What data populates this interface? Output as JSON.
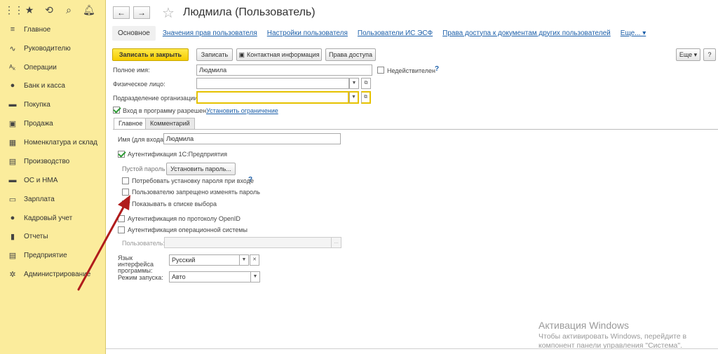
{
  "sidebar": {
    "top_icons": [
      "grid-icon",
      "star-icon",
      "history-icon",
      "search-icon",
      "bell-icon"
    ],
    "items": [
      {
        "label": "Главное",
        "icon": "≡"
      },
      {
        "label": "Руководителю",
        "icon": "∿"
      },
      {
        "label": "Операции",
        "icon": "ᴬₖ"
      },
      {
        "label": "Банк и касса",
        "icon": "●"
      },
      {
        "label": "Покупка",
        "icon": "▬"
      },
      {
        "label": "Продажа",
        "icon": "▣"
      },
      {
        "label": "Номенклатура и склад",
        "icon": "▦"
      },
      {
        "label": "Производство",
        "icon": "▤"
      },
      {
        "label": "ОС и НМА",
        "icon": "▬"
      },
      {
        "label": "Зарплата",
        "icon": "▭"
      },
      {
        "label": "Кадровый учет",
        "icon": "●"
      },
      {
        "label": "Отчеты",
        "icon": "▮"
      },
      {
        "label": "Предприятие",
        "icon": "▤"
      },
      {
        "label": "Администрирование",
        "icon": "✲"
      }
    ]
  },
  "header": {
    "back": "←",
    "forward": "→",
    "star": "☆",
    "title": "Людмила (Пользователь)"
  },
  "tabs": {
    "main": "Основное",
    "t1": "Значения прав пользователя",
    "t2": "Настройки пользователя",
    "t3": "Пользователи ИС ЭСФ",
    "t4": "Права доступа к документам других пользователей",
    "more": "Еще... ▾"
  },
  "toolbar": {
    "save_close": "Записать и закрыть",
    "save": "Записать",
    "contact": "Контактная информация",
    "access": "Права доступа",
    "more": "Еще ▾",
    "help": "?"
  },
  "form": {
    "full_name_label": "Полное имя:",
    "full_name_value": "Людмила",
    "inactive_label": "Недействителен",
    "person_label": "Физическое лицо:",
    "person_value": "",
    "dept_label": "Подразделение организации:",
    "dept_value": "",
    "login_allowed_label": "Вход в программу разрешен",
    "set_restriction": "Установить ограничение"
  },
  "inner_tabs": {
    "main": "Главное",
    "comment": "Комментарий"
  },
  "auth": {
    "login_label": "Имя (для входа):",
    "login_value": "Людмила",
    "auth_1c": "Аутентификация 1С:Предприятия",
    "empty_password": "Пустой пароль",
    "set_password": "Установить пароль...",
    "require_change": "Потребовать установку пароля при входе",
    "deny_change": "Пользователю запрещено изменять пароль",
    "show_in_list": "Показывать в списке выбора",
    "openid": "Аутентификация по протоколу OpenID",
    "os_auth": "Аутентификация операционной системы",
    "user_label": "Пользователь:",
    "user_value": "",
    "lang_label": "Язык интерфейса программы:",
    "lang_value": "Русский",
    "mode_label": "Режим запуска:",
    "mode_value": "Авто"
  },
  "watermark": {
    "title": "Активация Windows",
    "sub": "Чтобы активировать Windows, перейдите в компонент панели управления \"Система\"."
  },
  "colors": {
    "sidebar": "#fbec9c",
    "accent_button": "#f6cc00",
    "link": "#1c5fa9",
    "arrow": "#b01c1c",
    "check": "#2e9b34"
  }
}
